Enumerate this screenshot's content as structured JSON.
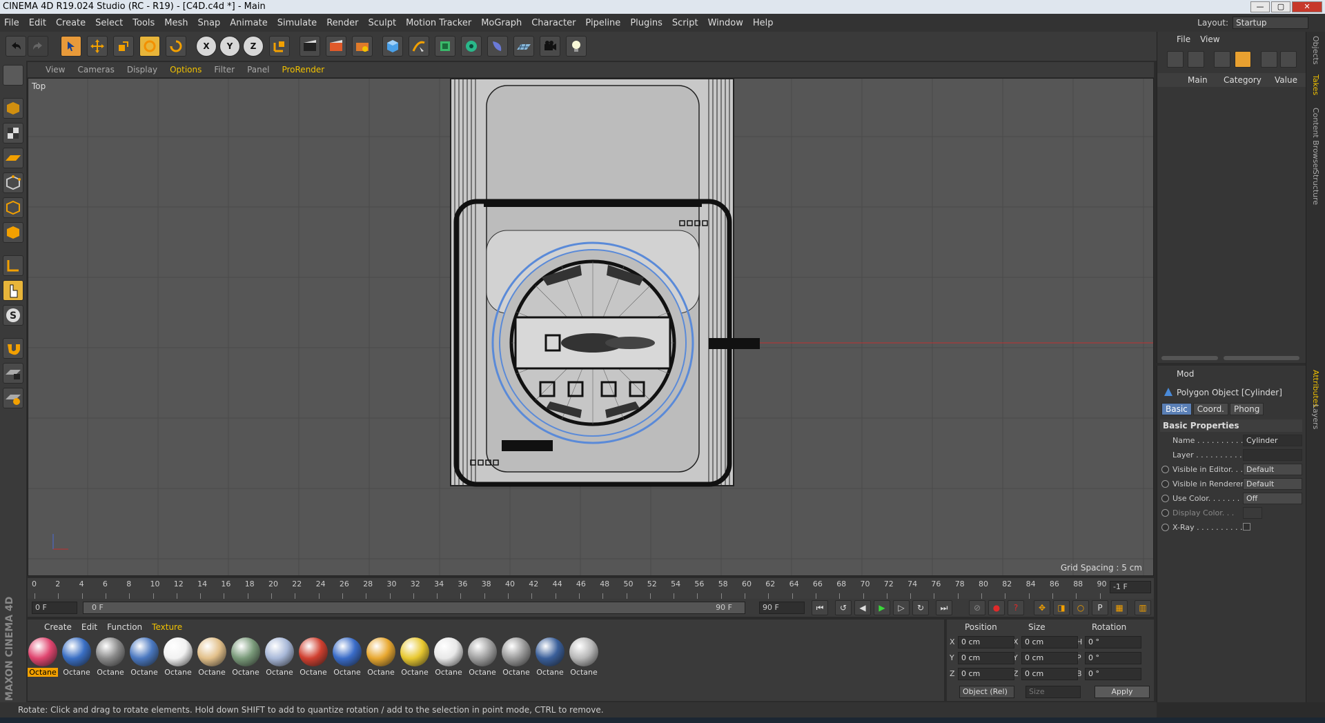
{
  "window": {
    "title": "CINEMA 4D R19.024 Studio (RC - R19) - [C4D.c4d *] - Main",
    "min": "—",
    "max": "▢",
    "close": "✕"
  },
  "menubar": [
    "File",
    "Edit",
    "Create",
    "Select",
    "Tools",
    "Mesh",
    "Snap",
    "Animate",
    "Simulate",
    "Render",
    "Sculpt",
    "Motion Tracker",
    "MoGraph",
    "Character",
    "Pipeline",
    "Plugins",
    "Script",
    "Window",
    "Help"
  ],
  "layout": {
    "label": "Layout:",
    "value": "Startup"
  },
  "toolbar": {
    "axis_x": "X",
    "axis_y": "Y",
    "axis_z": "Z"
  },
  "viewport": {
    "menu": [
      "View",
      "Cameras",
      "Display",
      "Options",
      "Filter",
      "Panel",
      "ProRender"
    ],
    "active_menu": "Options",
    "label": "Top",
    "grid_spacing": "Grid Spacing : 5 cm"
  },
  "timeline": {
    "ticks": [
      "0",
      "2",
      "4",
      "6",
      "8",
      "10",
      "12",
      "14",
      "16",
      "18",
      "20",
      "22",
      "24",
      "26",
      "28",
      "30",
      "32",
      "34",
      "36",
      "38",
      "40",
      "42",
      "44",
      "46",
      "48",
      "50",
      "52",
      "54",
      "56",
      "58",
      "60",
      "62",
      "64",
      "66",
      "68",
      "70",
      "72",
      "74",
      "76",
      "78",
      "80",
      "82",
      "84",
      "86",
      "88",
      "90"
    ],
    "current_frame": "-1 F"
  },
  "transport": {
    "start": "0 F",
    "range_start": "0 F",
    "range_end": "90 F",
    "end": "90 F"
  },
  "materials": {
    "menu": [
      "Create",
      "Edit",
      "Function",
      "Texture"
    ],
    "active_menu": "Texture",
    "items": [
      {
        "name": "Octane",
        "color": "#e0456f",
        "selected": true
      },
      {
        "name": "Octane",
        "color": "#3a6fc4",
        "selected": false
      },
      {
        "name": "Octane",
        "color": "#8a8a8a",
        "selected": false
      },
      {
        "name": "Octane",
        "color": "#4a78c0",
        "selected": false
      },
      {
        "name": "Octane",
        "color": "#f2f2f2",
        "selected": false
      },
      {
        "name": "Octane",
        "color": "#e2c08a",
        "selected": false
      },
      {
        "name": "Octane",
        "color": "#7a9a7a",
        "selected": false
      },
      {
        "name": "Octane",
        "color": "#a8b8d8",
        "selected": false
      },
      {
        "name": "Octane",
        "color": "#d04030",
        "selected": false
      },
      {
        "name": "Octane",
        "color": "#3a6cc8",
        "selected": false
      },
      {
        "name": "Octane",
        "color": "#e8a830",
        "selected": false
      },
      {
        "name": "Octane",
        "color": "#e8c830",
        "selected": false
      },
      {
        "name": "Octane",
        "color": "#e8e8e8",
        "selected": false
      },
      {
        "name": "Octane",
        "color": "#a0a0a0",
        "selected": false
      },
      {
        "name": "Octane",
        "color": "#9a9a9a",
        "selected": false
      },
      {
        "name": "Octane",
        "color": "#3a5f9a",
        "selected": false
      },
      {
        "name": "Octane",
        "color": "#b8b8b8",
        "selected": false
      }
    ]
  },
  "coords": {
    "position_label": "Position",
    "size_label": "Size",
    "rotation_label": "Rotation",
    "rows": [
      {
        "axis": "X",
        "pos": "0 cm",
        "saxis": "X",
        "size": "0 cm",
        "raxis": "H",
        "rot": "0 °"
      },
      {
        "axis": "Y",
        "pos": "0 cm",
        "saxis": "Y",
        "size": "0 cm",
        "raxis": "P",
        "rot": "0 °"
      },
      {
        "axis": "Z",
        "pos": "0 cm",
        "saxis": "Z",
        "size": "0 cm",
        "raxis": "B",
        "rot": "0 °"
      }
    ],
    "mode": "Object (Rel)",
    "size_mode": "Size",
    "apply": "Apply"
  },
  "objects": {
    "menu": [
      "File",
      "View"
    ],
    "cols": {
      "main": "Main",
      "category": "Category",
      "value": "Value"
    }
  },
  "attributes": {
    "menu": "Mod",
    "title": "Polygon Object [Cylinder]",
    "tabs": [
      "Basic",
      "Coord.",
      "Phong"
    ],
    "active_tab": "Basic",
    "section": "Basic Properties",
    "rows": [
      {
        "label": "Name . . . . . . . . . . .",
        "value": "Cylinder",
        "type": "input",
        "radio": false,
        "dim": false
      },
      {
        "label": "Layer . . . . . . . . . . .",
        "value": "",
        "type": "input",
        "radio": false,
        "dim": false
      },
      {
        "label": "Visible in Editor. . .",
        "value": "Default",
        "type": "select",
        "radio": true,
        "dim": false
      },
      {
        "label": "Visible in Renderer",
        "value": "Default",
        "type": "select",
        "radio": true,
        "dim": false
      },
      {
        "label": "Use Color. . . . . . .",
        "value": "Off",
        "type": "select",
        "radio": true,
        "dim": false
      },
      {
        "label": "Display Color. . .",
        "value": "",
        "type": "color",
        "radio": true,
        "dim": true
      },
      {
        "label": "X-Ray . . . . . . . . . .",
        "value": "",
        "type": "check",
        "radio": true,
        "dim": false
      }
    ]
  },
  "sidetabs": [
    "Objects",
    "Takes",
    "Content Browser",
    "Structure",
    "Attributes",
    "Layers"
  ],
  "status": "Rotate: Click and drag to rotate elements. Hold down SHIFT to add to quantize rotation / add to the selection in point mode, CTRL to remove.",
  "maxon": "MAXON CINEMA 4D"
}
